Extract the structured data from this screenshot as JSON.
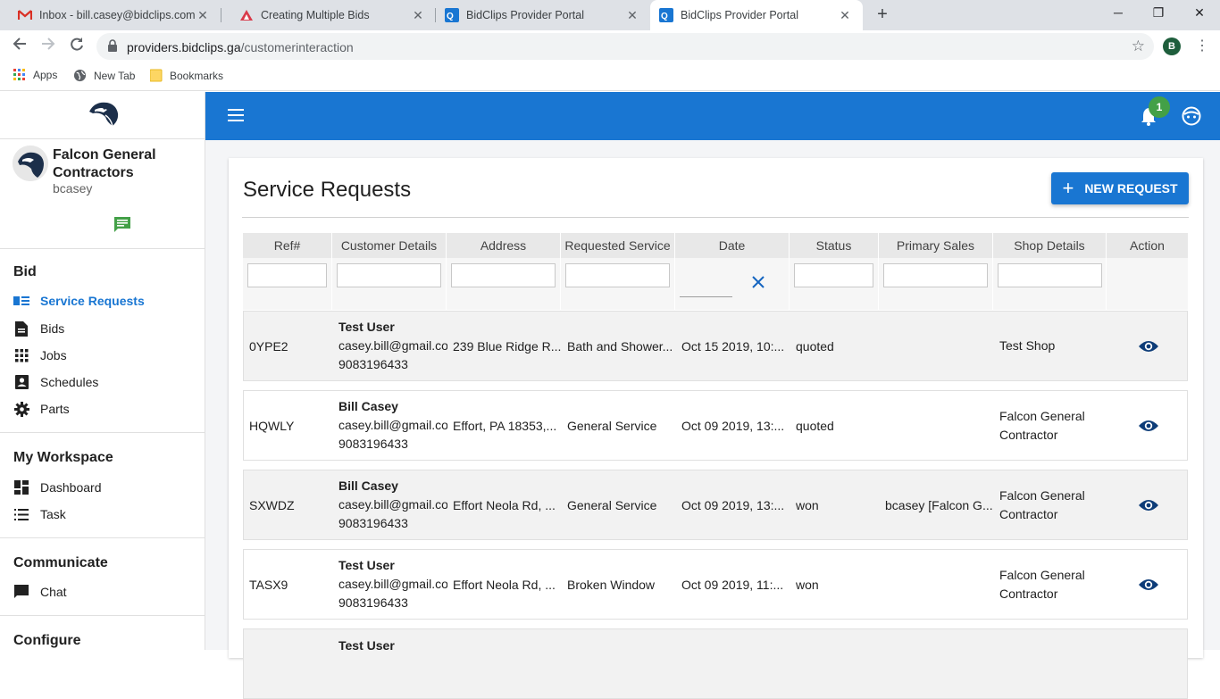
{
  "browser": {
    "tabs": [
      {
        "title": "Inbox - bill.casey@bidclips.com -",
        "icon": "gmail-icon"
      },
      {
        "title": "Creating Multiple Bids",
        "icon": "doc-icon"
      },
      {
        "title": "BidClips Provider Portal",
        "icon": "bidclips-icon"
      },
      {
        "title": "BidClips Provider Portal",
        "icon": "bidclips-icon"
      }
    ],
    "url_host": "providers.bidclips.ga",
    "url_path": "/customerinteraction",
    "profile_initial": "B",
    "bookmarks": [
      "Apps",
      "New Tab",
      "Bookmarks"
    ]
  },
  "sidebar": {
    "company": "Falcon General Contractors",
    "username": "bcasey",
    "sections": {
      "bid": "Bid",
      "workspace": "My Workspace",
      "communicate": "Communicate",
      "configure": "Configure"
    },
    "bid_items": [
      {
        "label": "Service Requests",
        "icon": "list-icon",
        "active": true
      },
      {
        "label": "Bids",
        "icon": "document-icon"
      },
      {
        "label": "Jobs",
        "icon": "grid-icon"
      },
      {
        "label": "Schedules",
        "icon": "contact-icon"
      },
      {
        "label": "Parts",
        "icon": "gear-icon"
      }
    ],
    "workspace_items": [
      {
        "label": "Dashboard",
        "icon": "dashboard-icon"
      },
      {
        "label": "Task",
        "icon": "tasklist-icon"
      }
    ],
    "communicate_items": [
      {
        "label": "Chat",
        "icon": "chat-icon"
      }
    ]
  },
  "header": {
    "notification_count": "1"
  },
  "page": {
    "title": "Service Requests",
    "new_request_label": "NEW REQUEST",
    "columns": [
      "Ref#",
      "Customer Details",
      "Address",
      "Requested Service",
      "Date",
      "Status",
      "Primary Sales",
      "Shop Details",
      "Action"
    ],
    "rows": [
      {
        "ref": "0YPE2",
        "name": "Test User",
        "email": "casey.bill@gmail.com",
        "phone": "9083196433",
        "address": "239 Blue Ridge R...",
        "service": "Bath and Shower...",
        "date": "Oct 15 2019, 10:...",
        "status": "quoted",
        "sales": "",
        "shop": "Test Shop"
      },
      {
        "ref": "HQWLY",
        "name": "Bill Casey",
        "email": "casey.bill@gmail.com",
        "phone": "9083196433",
        "address": "Effort, PA 18353,...",
        "service": "General Service",
        "date": "Oct 09 2019, 13:...",
        "status": "quoted",
        "sales": "",
        "shop": "Falcon General Contractor"
      },
      {
        "ref": "SXWDZ",
        "name": "Bill Casey",
        "email": "casey.bill@gmail.com",
        "phone": "9083196433",
        "address": "Effort Neola Rd, ...",
        "service": "General Service",
        "date": "Oct 09 2019, 13:...",
        "status": "won",
        "sales": "bcasey [Falcon G...",
        "shop": "Falcon General Contractor"
      },
      {
        "ref": "TASX9",
        "name": "Test User",
        "email": "casey.bill@gmail.com",
        "phone": "9083196433",
        "address": "Effort Neola Rd, ...",
        "service": "Broken Window",
        "date": "Oct 09 2019, 11:...",
        "status": "won",
        "sales": "",
        "shop": "Falcon General Contractor"
      },
      {
        "ref": "",
        "name": "Test User",
        "email": "",
        "phone": "",
        "address": "",
        "service": "",
        "date": "",
        "status": "",
        "sales": "",
        "shop": ""
      }
    ]
  }
}
